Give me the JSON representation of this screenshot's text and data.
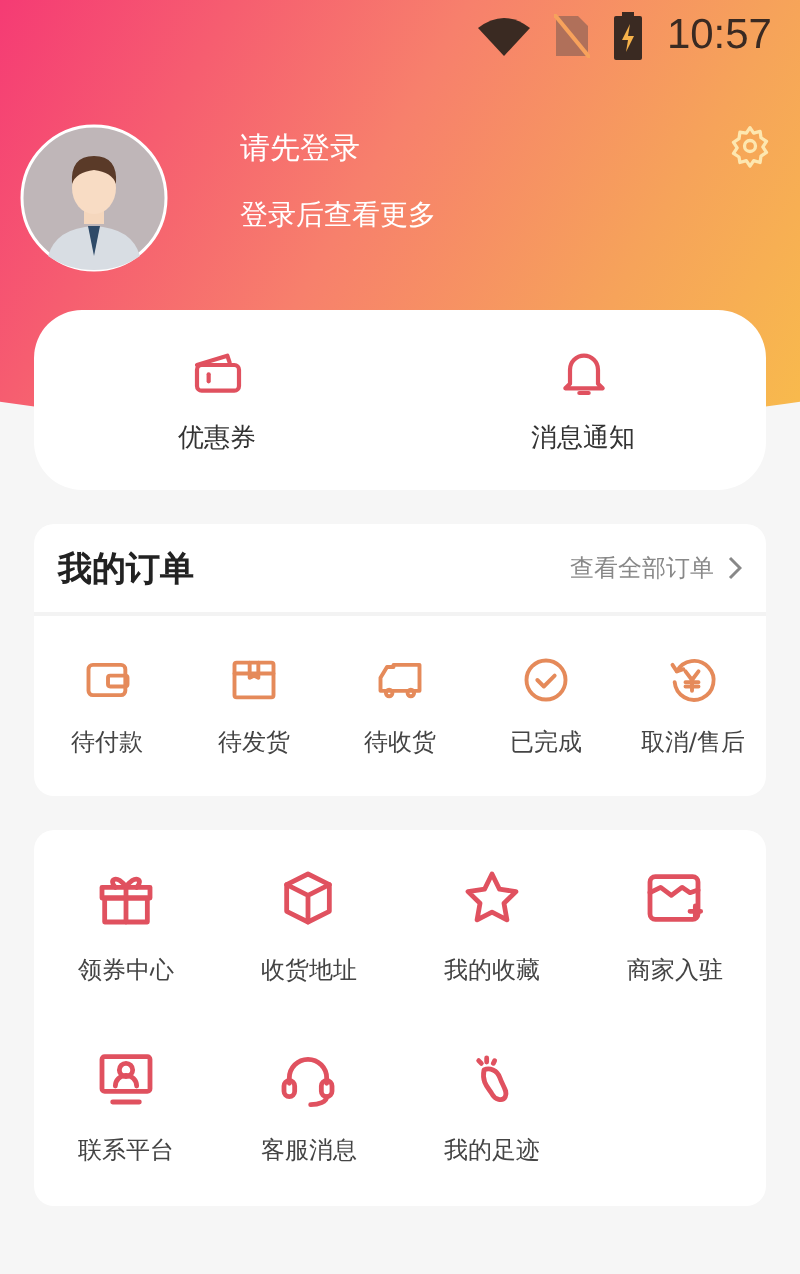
{
  "status_bar": {
    "time": "10:57"
  },
  "profile": {
    "name": "请先登录",
    "subtitle": "登录后查看更多"
  },
  "quick_links": [
    {
      "label": "优惠券"
    },
    {
      "label": "消息通知"
    }
  ],
  "orders": {
    "title": "我的订单",
    "view_all": "查看全部订单",
    "items": [
      {
        "label": "待付款"
      },
      {
        "label": "待发货"
      },
      {
        "label": "待收货"
      },
      {
        "label": "已完成"
      },
      {
        "label": "取消/售后"
      }
    ]
  },
  "services": [
    {
      "label": "领券中心"
    },
    {
      "label": "收货地址"
    },
    {
      "label": "我的收藏"
    },
    {
      "label": "商家入驻"
    },
    {
      "label": "联系平台"
    },
    {
      "label": "客服消息"
    },
    {
      "label": "我的足迹"
    }
  ]
}
